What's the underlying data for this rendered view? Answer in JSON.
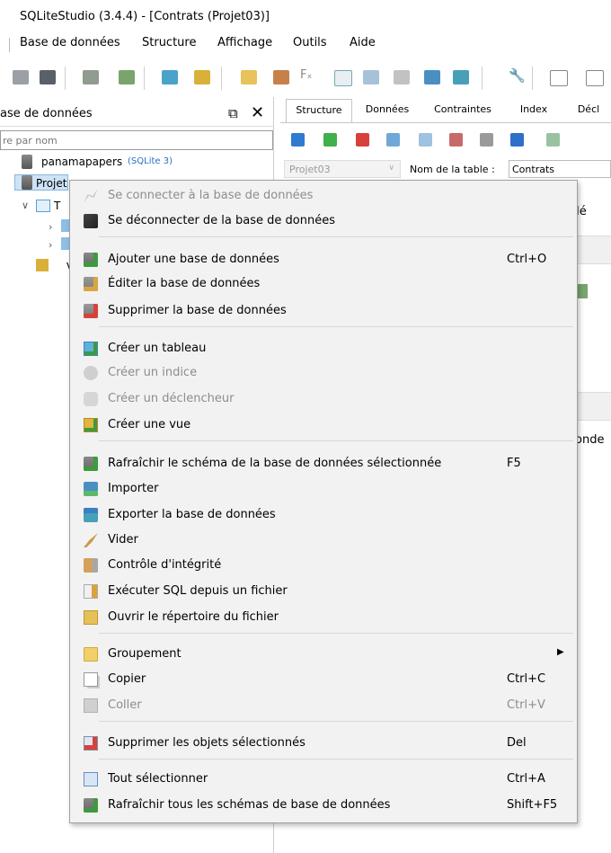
{
  "window": {
    "title": "SQLiteStudio (3.4.4) - [Contrats (Projet03)]"
  },
  "menubar": [
    "Base de données",
    "Structure",
    "Affichage",
    "Outils",
    "Aide"
  ],
  "toolbar": {
    "icons": [
      "connect-icon",
      "disconnect-icon",
      "add-db-icon",
      "edit-db-icon",
      "create-table-icon",
      "create-view-icon",
      "edit-icon",
      "sql-editor-icon",
      "function-icon",
      "json-icon",
      "package-icon",
      "import-icon",
      "export-icon",
      "wrench-icon",
      "tile-icon",
      "cascade-icon"
    ]
  },
  "dock": {
    "title": "ase de données",
    "filter_placeholder": "re par nom",
    "tree": {
      "db1_name": "panamapapers",
      "db1_type": "(SQLite 3)",
      "db2_name": "Projet",
      "node_t": "T",
      "node_v": "V"
    }
  },
  "editor": {
    "tabs": [
      "Structure",
      "Données",
      "Contraintes",
      "Index",
      "Décl"
    ],
    "db_combo": "Projet03",
    "table_name_label": "Nom de la table :",
    "table_name_value": "Contrats",
    "partial_text_1": "Clé",
    "partial_text_2": "onde"
  },
  "context_menu": {
    "items": [
      {
        "label": "Se connecter à la base de données",
        "shortcut": "",
        "disabled": true,
        "icon": "connect-icon"
      },
      {
        "label": "Se déconnecter de la base de données",
        "shortcut": "",
        "disabled": false,
        "icon": "disconnect-icon"
      },
      {
        "label": "Ajouter une base de données",
        "shortcut": "Ctrl+O",
        "disabled": false,
        "icon": "add-database-icon"
      },
      {
        "label": "Éditer la base de données",
        "shortcut": "",
        "disabled": false,
        "icon": "edit-database-icon"
      },
      {
        "label": "Supprimer la base de données",
        "shortcut": "",
        "disabled": false,
        "icon": "delete-database-icon"
      },
      {
        "label": "Créer un tableau",
        "shortcut": "",
        "disabled": false,
        "icon": "create-table-icon"
      },
      {
        "label": "Créer un indice",
        "shortcut": "",
        "disabled": true,
        "icon": "create-index-icon"
      },
      {
        "label": "Créer un déclencheur",
        "shortcut": "",
        "disabled": true,
        "icon": "create-trigger-icon"
      },
      {
        "label": "Créer une vue",
        "shortcut": "",
        "disabled": false,
        "icon": "create-view-icon"
      },
      {
        "label": "Rafraîchir le schéma de la base de données sélectionnée",
        "shortcut": "F5",
        "disabled": false,
        "icon": "refresh-schema-icon"
      },
      {
        "label": "Importer",
        "shortcut": "",
        "disabled": false,
        "icon": "import-icon"
      },
      {
        "label": "Exporter la base de données",
        "shortcut": "",
        "disabled": false,
        "icon": "export-icon"
      },
      {
        "label": "Vider",
        "shortcut": "",
        "disabled": false,
        "icon": "broom-icon"
      },
      {
        "label": "Contrôle d'intégrité",
        "shortcut": "",
        "disabled": false,
        "icon": "integrity-check-icon"
      },
      {
        "label": "Exécuter SQL depuis un fichier",
        "shortcut": "",
        "disabled": false,
        "icon": "execute-sql-file-icon"
      },
      {
        "label": "Ouvrir le répertoire du fichier",
        "shortcut": "",
        "disabled": false,
        "icon": "open-directory-icon"
      },
      {
        "label": "Groupement",
        "shortcut": "",
        "disabled": false,
        "icon": "folder-icon",
        "submenu": true
      },
      {
        "label": "Copier",
        "shortcut": "Ctrl+C",
        "disabled": false,
        "icon": "copy-icon"
      },
      {
        "label": "Coller",
        "shortcut": "Ctrl+V",
        "disabled": true,
        "icon": "paste-icon"
      },
      {
        "label": "Supprimer les objets sélectionnés",
        "shortcut": "Del",
        "disabled": false,
        "icon": "delete-objects-icon"
      },
      {
        "label": "Tout sélectionner",
        "shortcut": "Ctrl+A",
        "disabled": false,
        "icon": "select-all-icon"
      },
      {
        "label": "Rafraîchir tous les schémas de base de données",
        "shortcut": "Shift+F5",
        "disabled": false,
        "icon": "refresh-all-icon"
      }
    ]
  }
}
